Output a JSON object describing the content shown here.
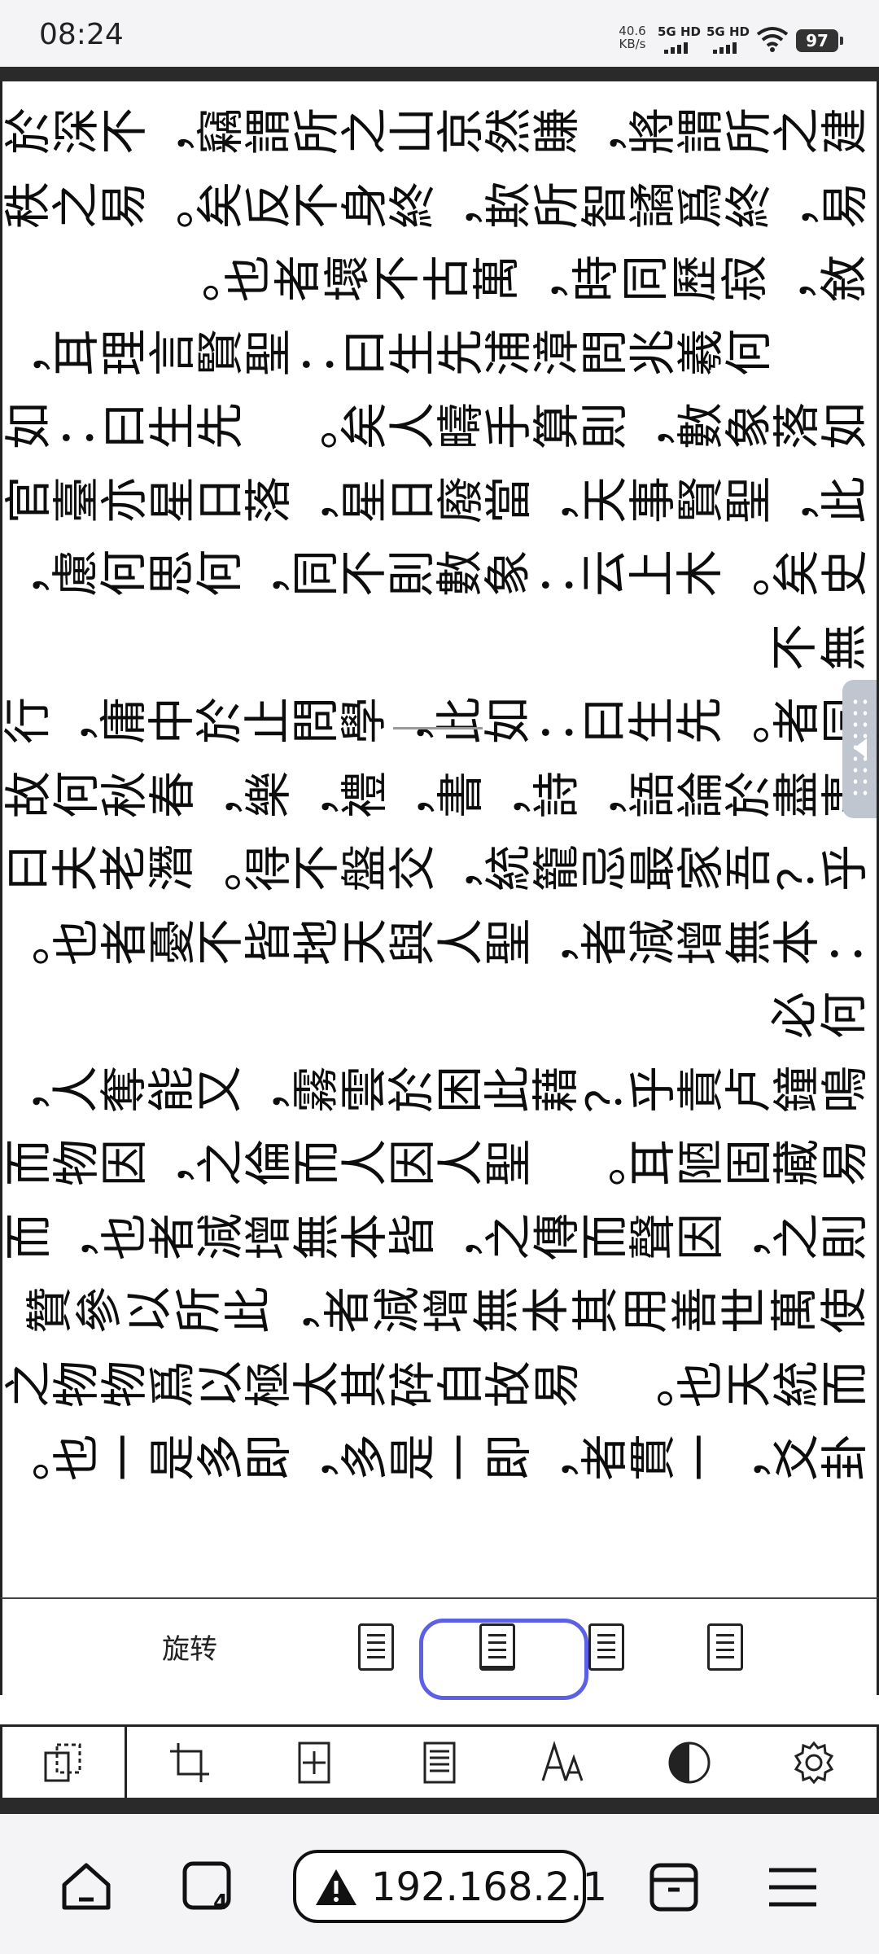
{
  "status_bar": {
    "time": "08:24",
    "net_speed_value": "40.6",
    "net_speed_unit": "KB/s",
    "sim1_label": "5G HD",
    "sim2_label": "5G HD",
    "battery": "97"
  },
  "document": {
    "columns": [
      "建之所謂將，賺然京山之所謂竊，不深於",
      "易，終爲譎智所欺，終身不反矣。 易之秩",
      "敘，寂歷同時，萬古不壞者也。",
      "　　何羲兆問漳浦先生曰：聖賢言理耳，",
      "如落象數，則算手疇人矣。 先生曰：如",
      "此，聖賢事天，當廢日星，落日星亦臺官稗",
      "史矣。 木上云：象數則不同，何思何慮，",
      "無不",
      "同者。 先生曰：如此，學問止於中庸，行",
      "事盡於論語，詩，書，禮，樂，春秋何故作",
      "乎？吾家最忌籠統，交盤不得。 潛老夫曰",
      "：本無增減者，聖人與天地皆不憂者也。",
      "何必",
      "鳴鐘卢責乎？ 藉此困於雲霧，又能奪人，",
      "易藏固陋耳。 聖人因人而倫之，因物而",
      "則之，因聲而傳之，皆本無增減者也，而能",
      "使萬世善用其本無增減者，此所以參贊",
      "而統天也。 易故自碎其太極以爲物物之",
      "卦爻，一貫者，即一是多，即多是一也。"
    ]
  },
  "reader_toolbar": {
    "rotate_label": "旋转",
    "align_options": [
      "align-top-icon",
      "align-center-icon",
      "align-right-icon",
      "align-bottom-icon"
    ],
    "selected_align_index": 1,
    "accent_color": "#5b60e6",
    "tabs": [
      "page-mode-icon",
      "crop-icon",
      "fit-width-icon",
      "text-layout-icon",
      "font-size-icon",
      "contrast-icon",
      "settings-icon"
    ]
  },
  "browser_nav": {
    "url": "192.168.2.1",
    "tab_count": "4"
  }
}
